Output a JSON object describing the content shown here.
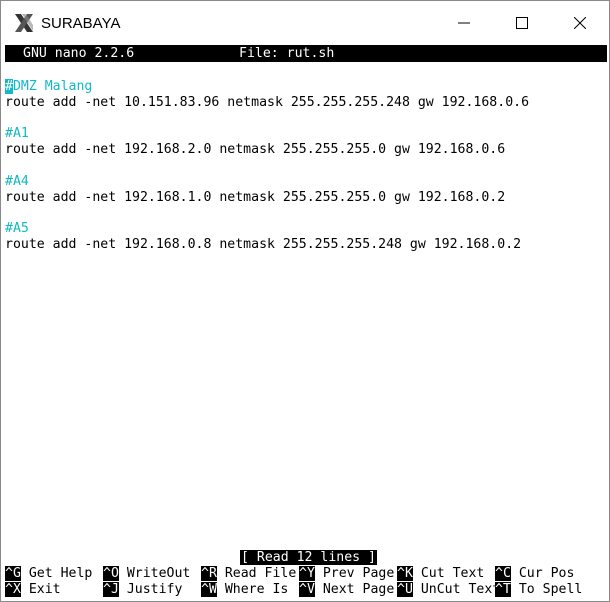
{
  "window": {
    "title": "SURABAYA"
  },
  "nano": {
    "version": "GNU nano 2.2.6",
    "file": "File: rut.sh"
  },
  "file_lines": [
    {
      "type": "comment",
      "cursor": "#",
      "text": "DMZ Malang"
    },
    {
      "type": "code",
      "text": "route add -net 10.151.83.96 netmask 255.255.255.248 gw 192.168.0.6"
    },
    {
      "type": "blank",
      "text": ""
    },
    {
      "type": "comment",
      "text": "#A1"
    },
    {
      "type": "code",
      "text": "route add -net 192.168.2.0 netmask 255.255.255.0 gw 192.168.0.6"
    },
    {
      "type": "blank",
      "text": ""
    },
    {
      "type": "comment",
      "text": "#A4"
    },
    {
      "type": "code",
      "text": "route add -net 192.168.1.0 netmask 255.255.255.0 gw 192.168.0.2"
    },
    {
      "type": "blank",
      "text": ""
    },
    {
      "type": "comment",
      "text": "#A5"
    },
    {
      "type": "code",
      "text": "route add -net 192.168.0.8 netmask 255.255.255.248 gw 192.168.0.2"
    }
  ],
  "status": "[ Read 12 lines ]",
  "shortcuts_row1": [
    {
      "key": "^G",
      "label": "Get Help"
    },
    {
      "key": "^O",
      "label": "WriteOut"
    },
    {
      "key": "^R",
      "label": "Read File"
    },
    {
      "key": "^Y",
      "label": "Prev Page"
    },
    {
      "key": "^K",
      "label": "Cut Text"
    },
    {
      "key": "^C",
      "label": "Cur Pos"
    }
  ],
  "shortcuts_row2": [
    {
      "key": "^X",
      "label": "Exit"
    },
    {
      "key": "^J",
      "label": "Justify"
    },
    {
      "key": "^W",
      "label": "Where Is"
    },
    {
      "key": "^V",
      "label": "Next Page"
    },
    {
      "key": "^U",
      "label": "UnCut Text"
    },
    {
      "key": "^T",
      "label": "To Spell"
    }
  ],
  "colors": {
    "comment": "#11b9c7",
    "header_bg": "#000000",
    "background": "#ffffff"
  },
  "icons": {
    "app": "x-logo-icon",
    "minimize": "minimize-icon",
    "maximize": "maximize-icon",
    "close": "close-icon"
  }
}
